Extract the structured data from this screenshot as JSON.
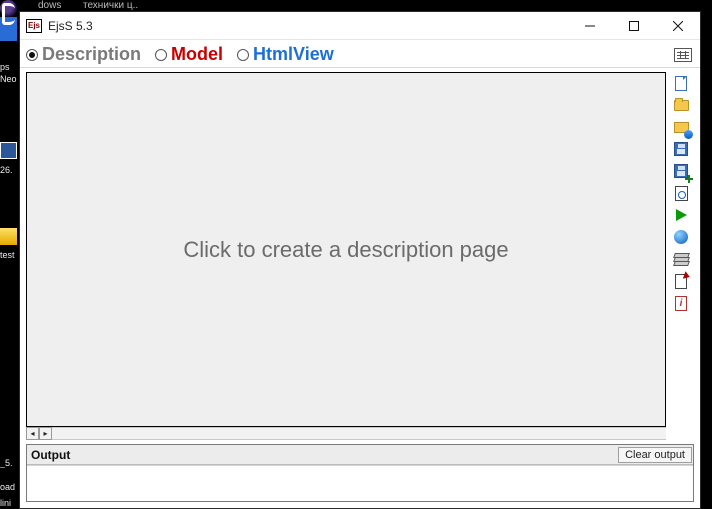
{
  "window": {
    "app_icon_text": "Ejs",
    "title": "EjsS 5.3"
  },
  "tabs": {
    "description": "Description",
    "model": "Model",
    "htmlview": "HtmlView",
    "selected": "description"
  },
  "canvas": {
    "placeholder": "Click to create a description page"
  },
  "output": {
    "label": "Output",
    "clear_label": "Clear output"
  },
  "right_tools": {
    "new": "new-file-icon",
    "open": "open-folder-icon",
    "open_web": "open-from-web-icon",
    "save": "save-icon",
    "save_as": "save-as-icon",
    "search": "search-icon",
    "run": "run-icon",
    "globe": "web-run-icon",
    "package": "package-icon",
    "options": "options-icon",
    "info": "info-icon"
  },
  "desktop": {
    "top_label_1": "dows",
    "top_label_2": "технички ц..",
    "lbl_ps": "ps",
    "lbl_neo": "Neo",
    "lbl_26": "26.",
    "lbl_test": "test",
    "lbl_5": "_5.",
    "lbl_oad": "oad",
    "lbl_lini": "lini"
  }
}
